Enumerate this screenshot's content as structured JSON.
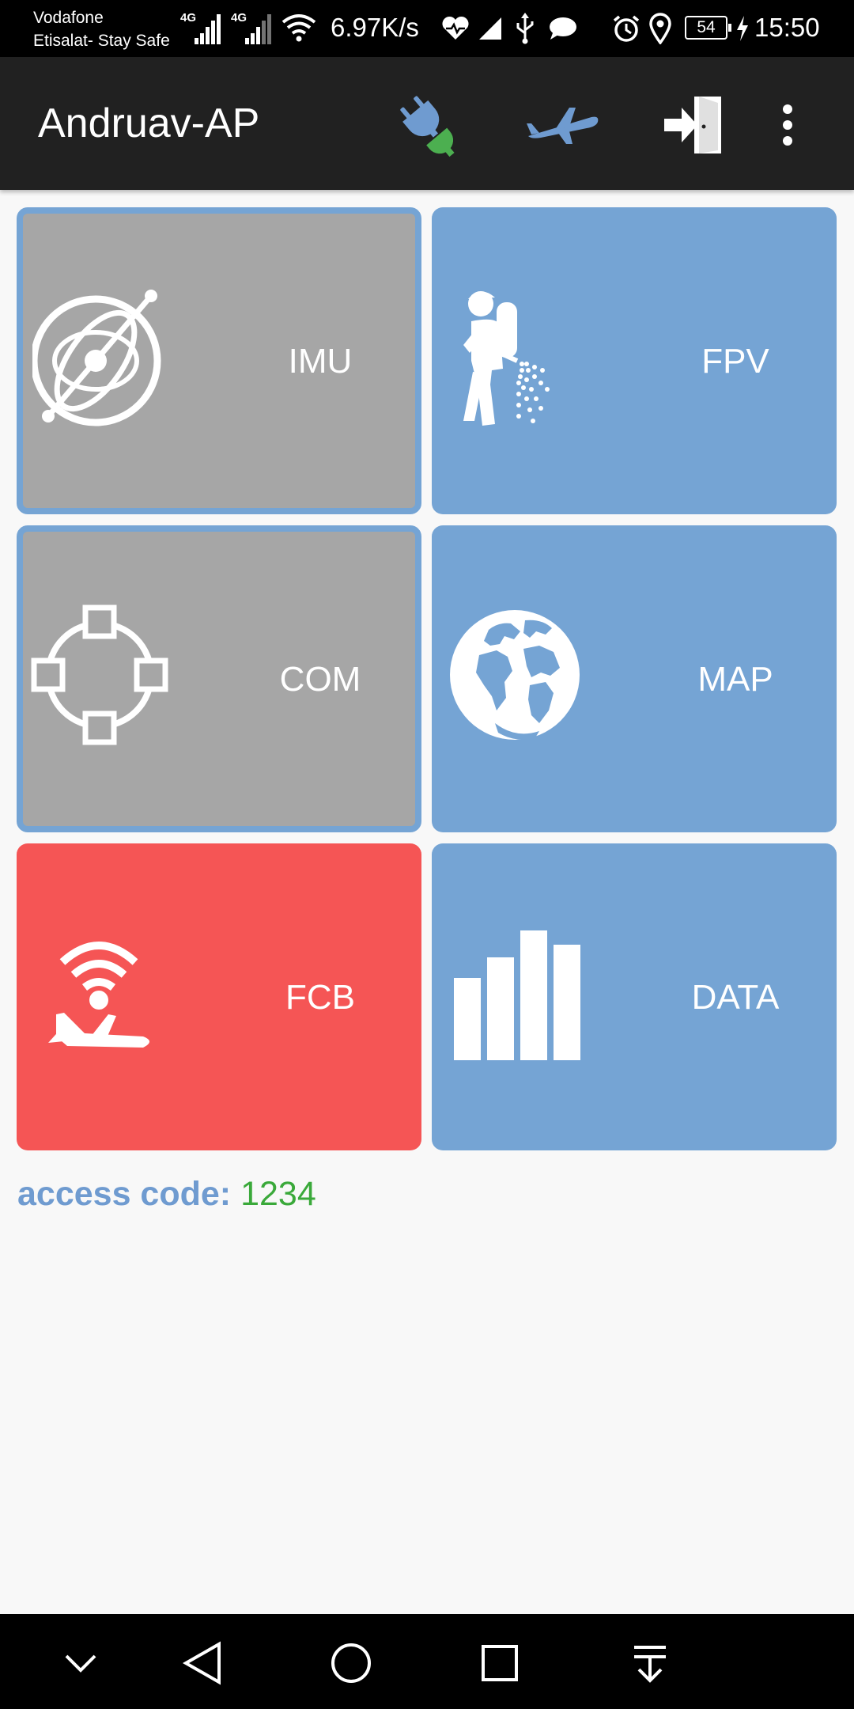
{
  "status_bar": {
    "carrier_line1": "Vodafone",
    "carrier_line2": "Etisalat- Stay Safe",
    "signal1_label": "4G",
    "signal2_label": "4G",
    "net_speed": "6.97K/s",
    "battery_level": "54",
    "time": "15:50",
    "icons": [
      "signal-icon",
      "signal-icon",
      "wifi-icon",
      "heart-rate-icon",
      "signal-triangle-icon",
      "usb-icon",
      "message-icon",
      "alarm-icon",
      "location-icon",
      "battery-icon",
      "charging-icon"
    ]
  },
  "app_bar": {
    "title": "Andruav-AP",
    "actions": [
      "plug-connect-icon",
      "airplane-icon",
      "exit-door-icon",
      "more-vert-icon"
    ],
    "colors": {
      "plug_green": "#4caf50",
      "plug_blue": "#6f9bd0",
      "plane_blue": "#6f9bd0"
    }
  },
  "tiles": [
    {
      "label": "IMU",
      "icon": "imu-gyro-icon",
      "state": "inactive"
    },
    {
      "label": "FPV",
      "icon": "sprayer-person-icon",
      "state": "active"
    },
    {
      "label": "COM",
      "icon": "network-nodes-icon",
      "state": "inactive"
    },
    {
      "label": "MAP",
      "icon": "globe-icon",
      "state": "active"
    },
    {
      "label": "FCB",
      "icon": "plane-signal-icon",
      "state": "alert"
    },
    {
      "label": "DATA",
      "icon": "bar-chart-icon",
      "state": "active"
    }
  ],
  "tile_colors": {
    "active": "#75a4d4",
    "inactive": "#a6a6a6",
    "alert": "#f55555"
  },
  "access": {
    "label": "access code:",
    "value": "1234"
  },
  "nav_bar": {
    "buttons": [
      "chevron-down-icon",
      "back-icon",
      "home-icon",
      "recents-icon",
      "notification-pull-icon"
    ]
  }
}
